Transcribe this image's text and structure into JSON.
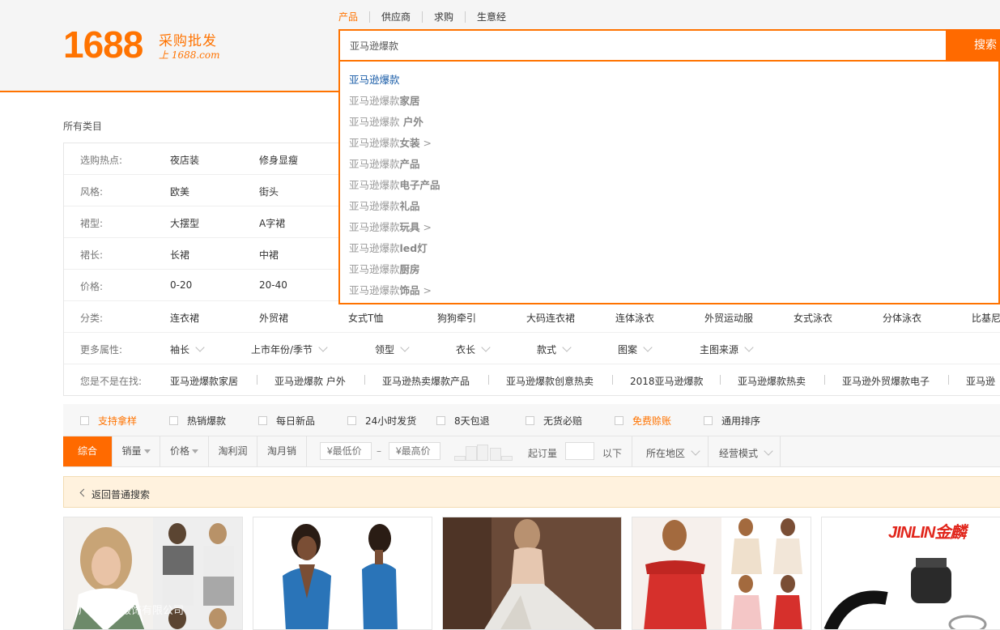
{
  "header": {
    "logo_number": "1688",
    "logo_tagline": "采购批发",
    "logo_sub": "上 1688.com",
    "search_tabs": [
      {
        "label": "产品",
        "active": true
      },
      {
        "label": "供应商",
        "active": false
      },
      {
        "label": "求购",
        "active": false
      },
      {
        "label": "生意经",
        "active": false
      }
    ],
    "search_value": "亚马逊爆款",
    "search_button": "搜索",
    "accent_color": "#ff7300"
  },
  "suggestions": [
    {
      "base": "亚马逊爆款",
      "suffix": "",
      "arrow": ""
    },
    {
      "base": "亚马逊爆款",
      "suffix": "家居",
      "arrow": ""
    },
    {
      "base": "亚马逊爆款",
      "suffix": " 户外",
      "arrow": ""
    },
    {
      "base": "亚马逊爆款",
      "suffix": "女装",
      "arrow": ">"
    },
    {
      "base": "亚马逊爆款",
      "suffix": "产品",
      "arrow": ""
    },
    {
      "base": "亚马逊爆款",
      "suffix": "电子产品",
      "arrow": ""
    },
    {
      "base": "亚马逊爆款",
      "suffix": "礼品",
      "arrow": ""
    },
    {
      "base": "亚马逊爆款",
      "suffix": "玩具",
      "arrow": ">"
    },
    {
      "base": "亚马逊爆款",
      "suffix": "led灯",
      "arrow": ""
    },
    {
      "base": "亚马逊爆款",
      "suffix": "厨房",
      "arrow": ""
    },
    {
      "base": "亚马逊爆款",
      "suffix": "饰品",
      "arrow": ">"
    }
  ],
  "category_label": "所有类目",
  "filters": {
    "hot": {
      "label": "选购热点:",
      "values": [
        "夜店装",
        "修身显瘦"
      ]
    },
    "style": {
      "label": "风格:",
      "values": [
        "欧美",
        "街头"
      ]
    },
    "skirt_type": {
      "label": "裙型:",
      "values": [
        "大摆型",
        "A字裙"
      ]
    },
    "skirt_length": {
      "label": "裙长:",
      "values": [
        "长裙",
        "中裙"
      ]
    },
    "price": {
      "label": "价格:",
      "values": [
        "0-20",
        "20-40"
      ]
    },
    "category": {
      "label": "分类:",
      "values": [
        "连衣裙",
        "外贸裙",
        "女式T恤",
        "狗狗牵引",
        "大码连衣裙",
        "连体泳衣",
        "外贸运动服",
        "女式泳衣",
        "分体泳衣",
        "比基尼"
      ]
    },
    "more": {
      "label": "更多属性:",
      "values": [
        "袖长",
        "上市年份/季节",
        "领型",
        "衣长",
        "款式",
        "图案",
        "主图来源"
      ]
    },
    "related": {
      "label": "您是不是在找:",
      "values": [
        "亚马逊爆款家居",
        "亚马逊爆款 户外",
        "亚马逊热卖爆款产品",
        "亚马逊爆款创意热卖",
        "2018亚马逊爆款",
        "亚马逊爆款热卖",
        "亚马逊外贸爆款电子",
        "亚马逊"
      ]
    }
  },
  "services": [
    {
      "label": "支持拿样",
      "orange": true
    },
    {
      "label": "热销爆款",
      "orange": false
    },
    {
      "label": "每日新品",
      "orange": false
    },
    {
      "label": "24小时发货",
      "orange": false
    },
    {
      "label": "8天包退",
      "orange": false
    },
    {
      "label": "无货必赔",
      "orange": false
    },
    {
      "label": "免费赊账",
      "orange": true
    },
    {
      "label": "通用排序",
      "orange": false
    }
  ],
  "sort": {
    "comprehensive": "综合",
    "sales": "销量",
    "price": "价格",
    "taobao_profit": "淘利润",
    "taobao_monthly": "淘月销",
    "min_price_placeholder": "¥最低价",
    "dash": "–",
    "max_price_placeholder": "¥最高价",
    "moq_label": "起订量",
    "below_label": "以下",
    "region": "所在地区",
    "business_mode": "经营模式"
  },
  "back_link": "返回普通搜索",
  "cards": [
    {
      "watermark": "广州曼迪服饰有限公司"
    },
    {
      "watermark": ""
    },
    {
      "watermark": ""
    },
    {
      "watermark": ""
    },
    {
      "brand": "JINLIN金麟"
    }
  ]
}
